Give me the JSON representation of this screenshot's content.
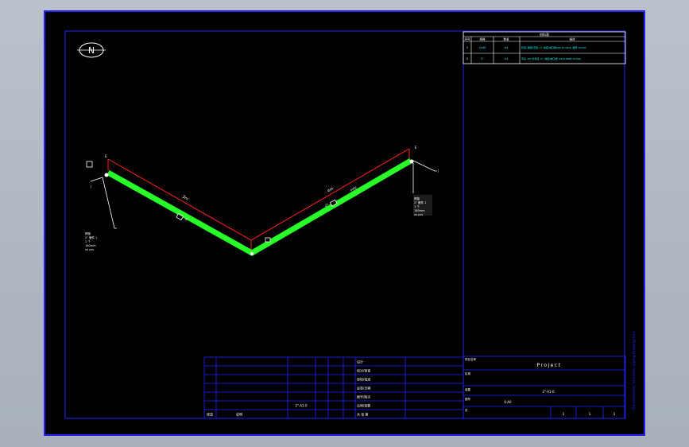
{
  "drawing": {
    "north_label": "N",
    "pipe_line_id": "2\"-A1-0",
    "dim_left": "3m",
    "dim_right": "4m",
    "seg_tag_left": "2\"",
    "seg_tag_right": "2\"",
    "flow_label": "PIPE",
    "end_tags": [
      "E",
      "E"
    ],
    "left_note": [
      "焊接",
      "2\" 管件 1",
      "1 个",
      "180mm",
      "xx pcs"
    ],
    "right_note": [
      "焊接",
      "2\" 管件 1",
      "1 个",
      "180mm",
      "xx pcs"
    ]
  },
  "bom": {
    "title": "材料表",
    "headers": [
      "序号",
      "规格",
      "数量",
      "描述"
    ],
    "rows": [
      {
        "no": "1",
        "spec": "2x40",
        "qty": "x4",
        "desc": "管道, 碳钢/无缝, 2\", 焊接/坡口端/API 5L GR.B, 壁厚 SCH40"
      },
      {
        "no": "2",
        "spec": "2\"",
        "qty": "x4",
        "desc": "弯头, 90°长半径, 2\", 焊接/坡口端, A234 WPB, SCH40"
      }
    ]
  },
  "title_block": {
    "labels": [
      "设计",
      "校对/审查",
      "审核/批准",
      "会签/日期",
      "图号/版次",
      "比例/张数",
      "共 张 第"
    ],
    "drawing_no": "2\"-A1-0",
    "bottom_left": [
      "修改",
      "说明"
    ],
    "project_label": "项目名称",
    "project_name": "Project",
    "area_label": "区域",
    "unit_label": "装置",
    "unit_value": "2\"-A1-0",
    "drawing_label": "图号",
    "drawing_value": "0-A0",
    "sheet_label": "页",
    "sheet_values": [
      "1",
      "1",
      "1"
    ]
  },
  "side_text": "Generated by isometric piping drawing tool",
  "colors": {
    "frame": "#2222ff",
    "pipe": "#28ff28",
    "dim": "#ff2020",
    "text": "#ffffff",
    "cyan": "#00ffff"
  }
}
